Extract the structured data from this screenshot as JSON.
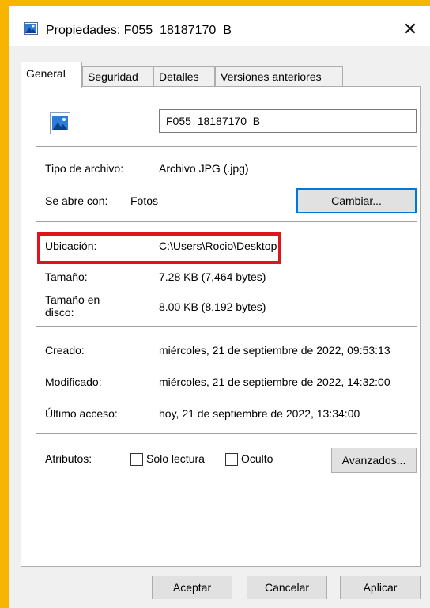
{
  "window": {
    "title": "Propiedades: F055_18187170_B",
    "close_glyph": "✕"
  },
  "tabs": [
    {
      "label": "General",
      "active": true
    },
    {
      "label": "Seguridad",
      "active": false
    },
    {
      "label": "Detalles",
      "active": false
    },
    {
      "label": "Versiones anteriores",
      "active": false
    }
  ],
  "file": {
    "name": "F055_18187170_B",
    "icon": "image-file-icon"
  },
  "type": {
    "label": "Tipo de archivo:",
    "value": "Archivo JPG (.jpg)"
  },
  "opens_with": {
    "label": "Se abre con:",
    "value": "Fotos",
    "change_button": "Cambiar..."
  },
  "location": {
    "label": "Ubicación:",
    "value": "C:\\Users\\Rocio\\Desktop"
  },
  "size": {
    "label": "Tamaño:",
    "value": "7.28 KB (7,464 bytes)"
  },
  "size_on_disk": {
    "label_line1": "Tamaño en",
    "label_line2": "disco:",
    "value": "8.00 KB (8,192 bytes)"
  },
  "created": {
    "label": "Creado:",
    "value": "miércoles, 21 de septiembre de 2022, 09:53:13"
  },
  "modified": {
    "label": "Modificado:",
    "value": "miércoles, 21 de septiembre de 2022, 14:32:00"
  },
  "accessed": {
    "label": "Último acceso:",
    "value": "hoy, 21 de septiembre de 2022, 13:34:00"
  },
  "attributes": {
    "label": "Atributos:",
    "readonly_label": "Solo lectura",
    "readonly_checked": false,
    "hidden_label": "Oculto",
    "hidden_checked": false,
    "advanced_button": "Avanzados..."
  },
  "footer": {
    "ok": "Aceptar",
    "cancel": "Cancelar",
    "apply": "Aplicar"
  },
  "colors": {
    "highlight": "#e1131f",
    "accent": "#0078d7",
    "background": "#f7b500"
  }
}
